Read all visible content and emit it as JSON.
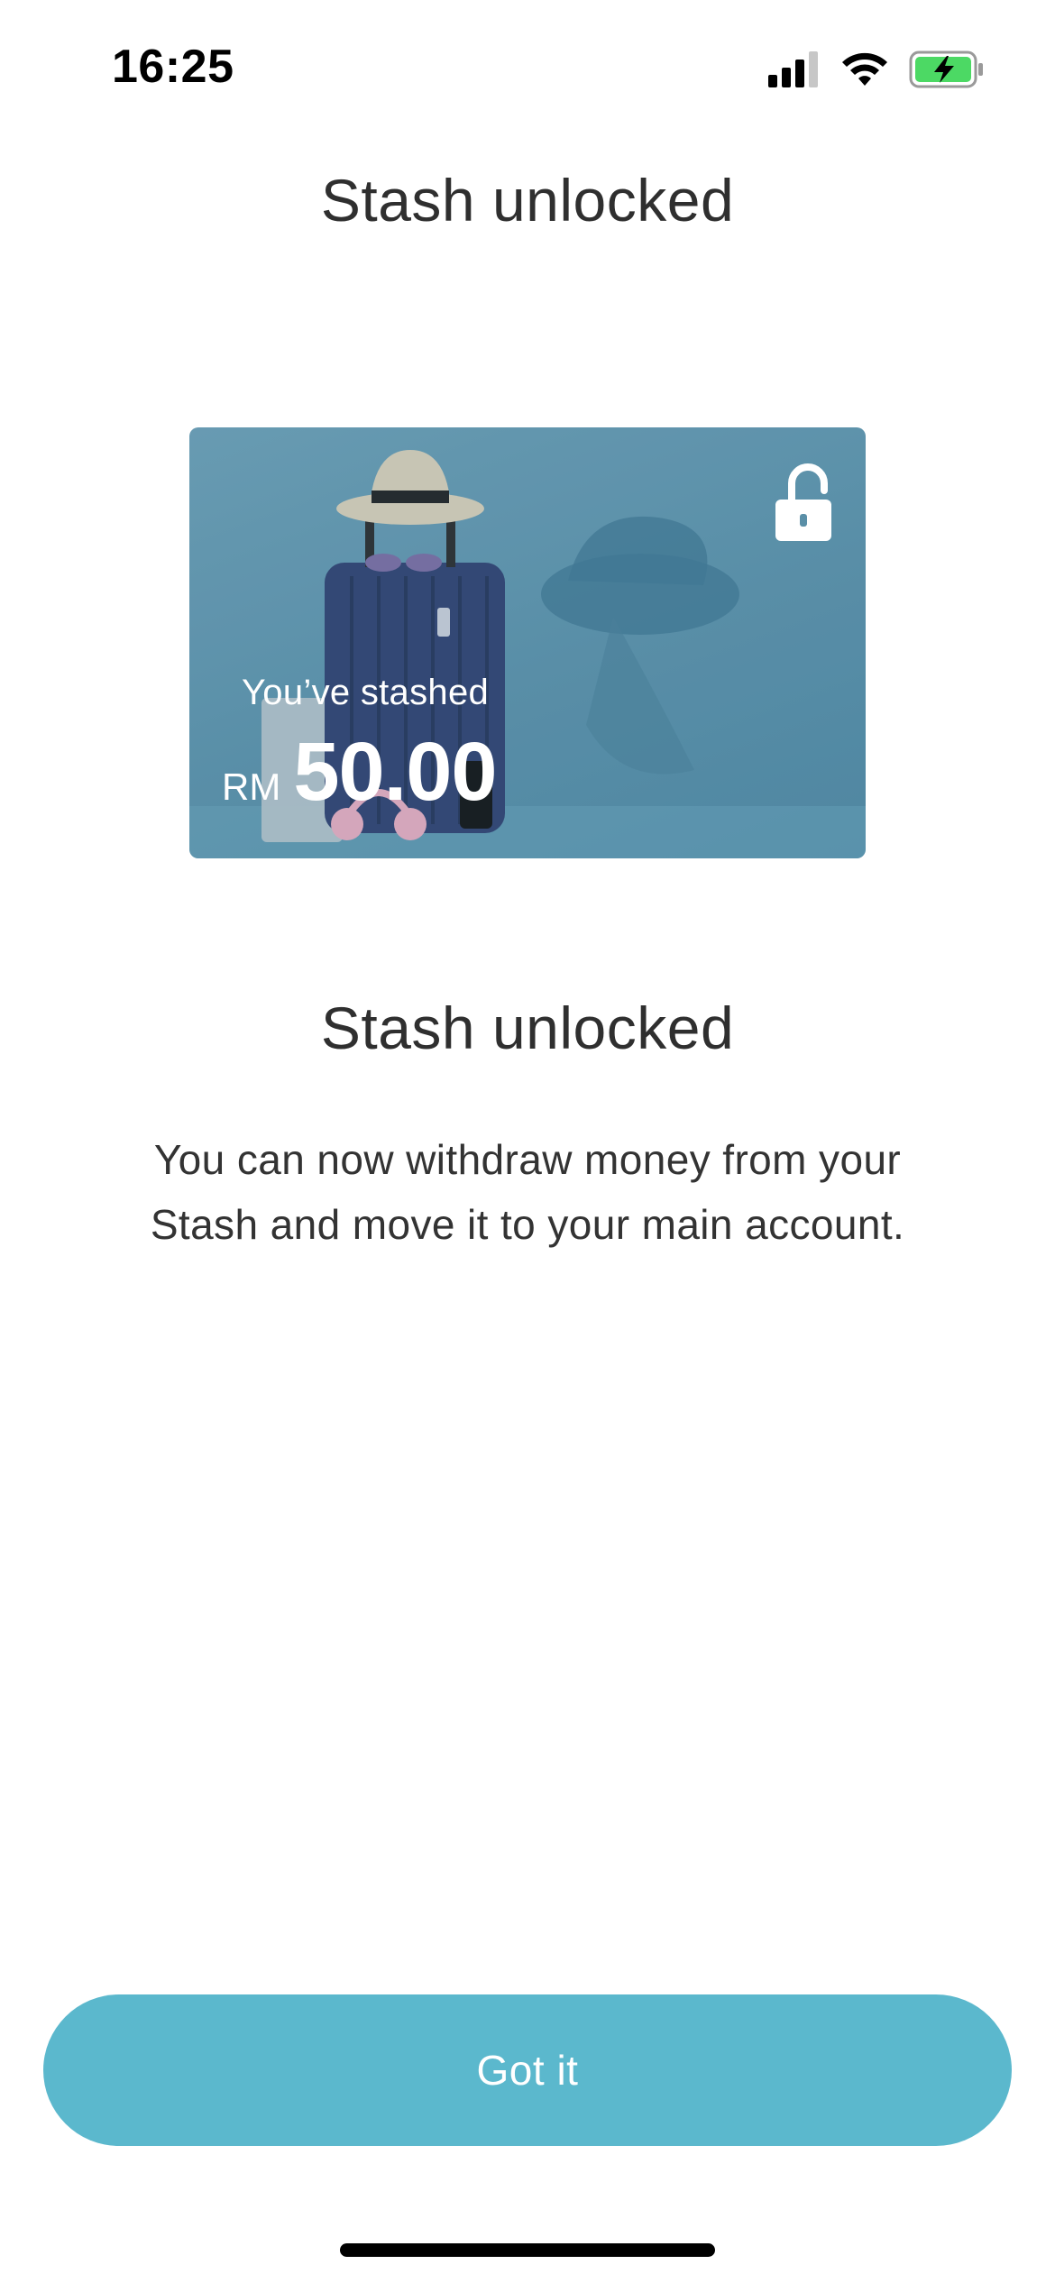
{
  "status_bar": {
    "time": "16:25",
    "icons": [
      "cellular-signal-icon",
      "wifi-icon",
      "battery-charging-icon"
    ]
  },
  "header": {
    "title": "Stash unlocked"
  },
  "card": {
    "stashed_label": "You’ve stashed",
    "currency": "RM",
    "amount": "50.00",
    "lock_state_icon": "unlocked-padlock-icon",
    "image_subject": "suitcase-with-hat-photo"
  },
  "content": {
    "title": "Stash unlocked",
    "description": "You can now withdraw money from your Stash and move it to your main account."
  },
  "actions": {
    "got_it_label": "Got it"
  },
  "colors": {
    "primary_button": "#5bb8cd",
    "card_background": "#5a8fa7",
    "text_primary": "#2f2f2f",
    "battery_green": "#4cd964"
  }
}
